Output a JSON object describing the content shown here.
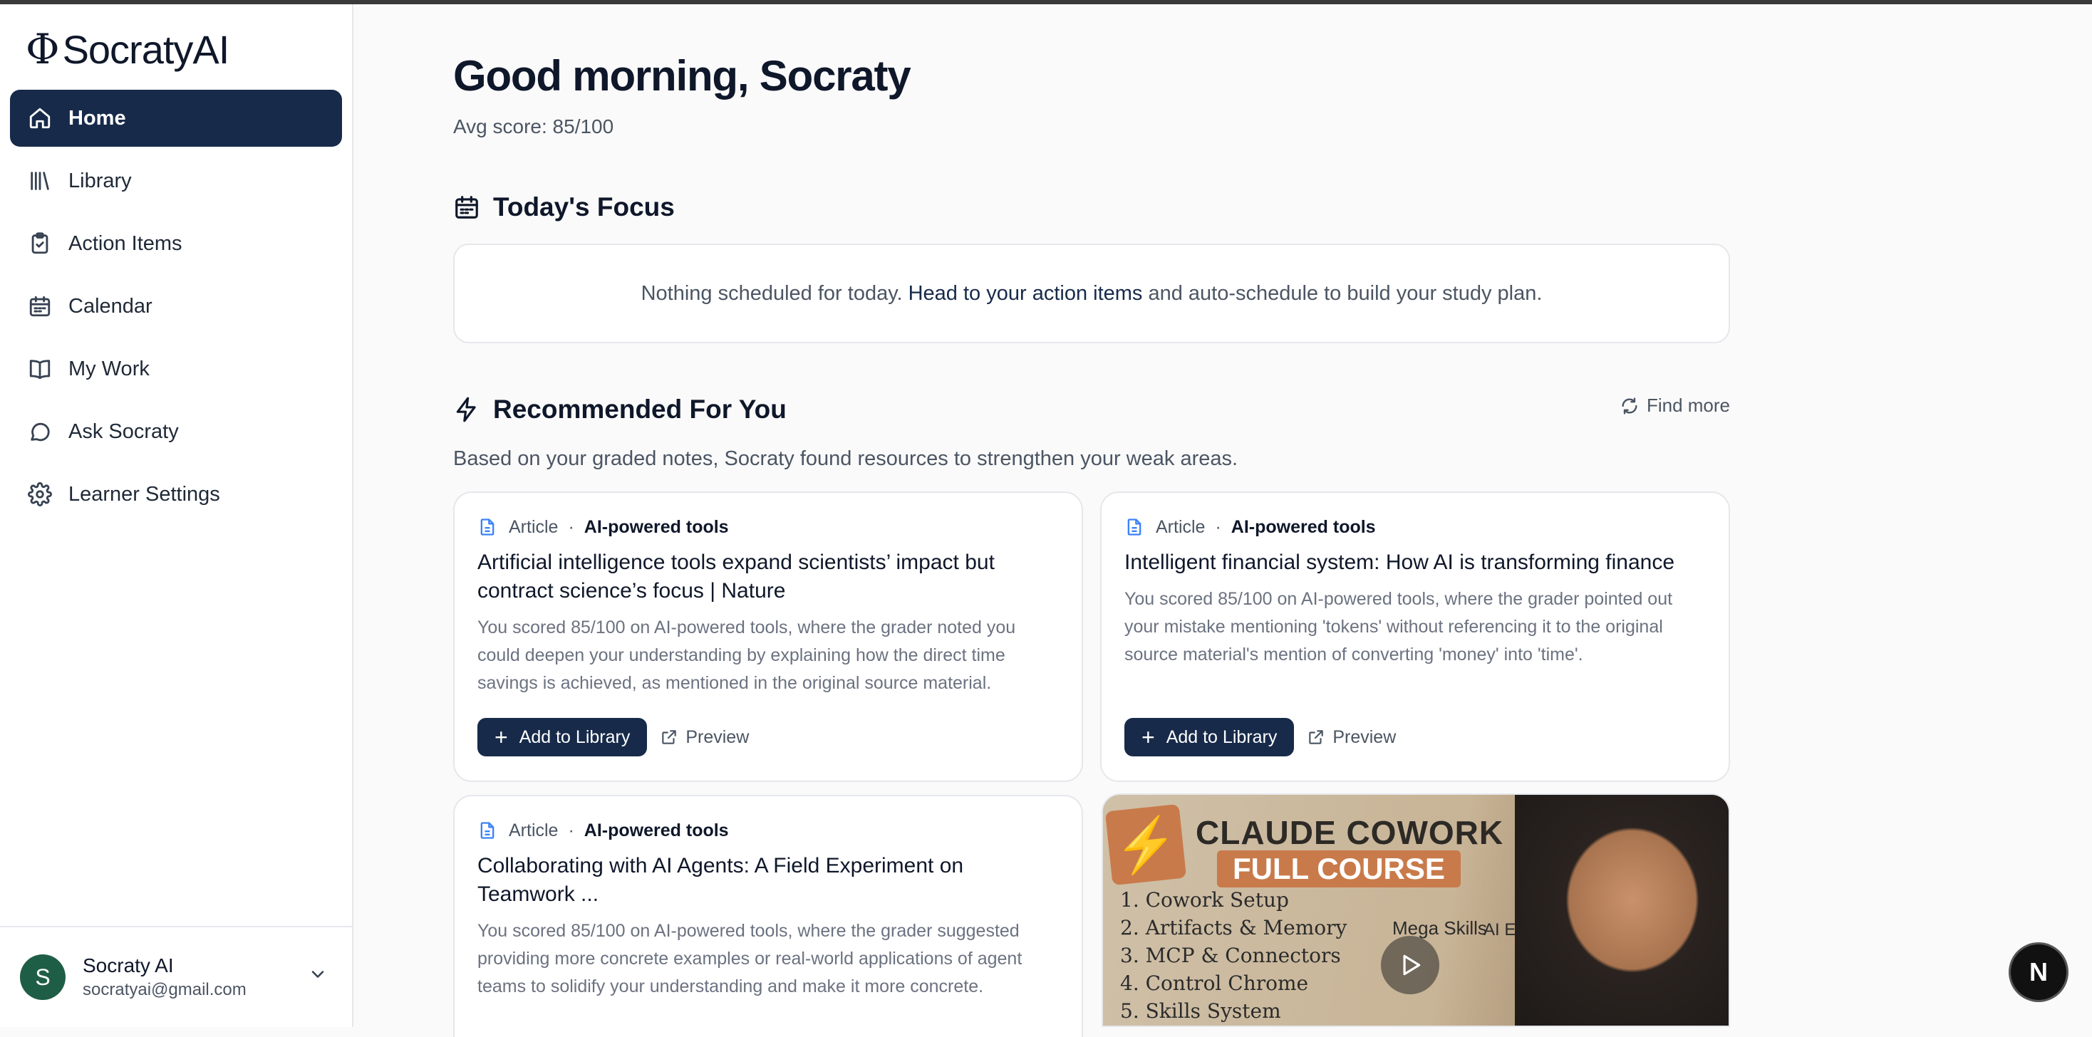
{
  "app": {
    "logo_symbol": "Φ",
    "name": "SocratyAI"
  },
  "sidebar": {
    "items": [
      {
        "label": "Home",
        "icon": "home-icon",
        "active": true
      },
      {
        "label": "Library",
        "icon": "library-icon"
      },
      {
        "label": "Action Items",
        "icon": "clipboard-check-icon"
      },
      {
        "label": "Calendar",
        "icon": "calendar-icon"
      },
      {
        "label": "My Work",
        "icon": "book-open-icon"
      },
      {
        "label": "Ask Socraty",
        "icon": "chat-bubble-icon"
      },
      {
        "label": "Learner Settings",
        "icon": "gear-icon"
      }
    ],
    "user": {
      "initial": "S",
      "name": "Socraty AI",
      "email": "socratyai@gmail.com"
    }
  },
  "main": {
    "greeting": "Good morning, Socraty",
    "avg_score": "Avg score: 85/100",
    "focus": {
      "title": "Today's Focus",
      "text_before": "Nothing scheduled for today.",
      "link": "Head to your action items",
      "text_after": "and auto-schedule to build your study plan."
    },
    "recommended": {
      "title": "Recommended For You",
      "find_more": "Find more",
      "description": "Based on your graded notes, Socraty found resources to strengthen your weak areas.",
      "separator": "·",
      "cards": [
        {
          "type": "Article",
          "tag": "AI-powered tools",
          "title": "Artificial intelligence tools expand scientists’ impact but contract science’s focus | Nature",
          "body": "You scored 85/100 on AI-powered tools, where the grader noted you could deepen your understanding by explaining how the direct time savings is achieved, as mentioned in the original source material.",
          "add_label": "Add to Library",
          "preview_label": "Preview"
        },
        {
          "type": "Article",
          "tag": "AI-powered tools",
          "title": "Intelligent financial system: How AI is transforming finance",
          "body": "You scored 85/100 on AI-powered tools, where the grader pointed out your mistake mentioning 'tokens' without referencing it to the original source material's mention of converting 'money' into 'time'.",
          "add_label": "Add to Library",
          "preview_label": "Preview"
        },
        {
          "type": "Article",
          "tag": "AI-powered tools",
          "title": "Collaborating with AI Agents: A Field Experiment on Teamwork ...",
          "body": "You scored 85/100 on AI-powered tools, where the grader suggested providing more concrete examples or real-world applications of agent teams to solidify your understanding and make it more concrete."
        }
      ],
      "video_thumbnail": {
        "title": "CLAUDE COWORK",
        "badge": "FULL COURSE",
        "items": [
          "1. Cowork Setup",
          "2. Artifacts & Memory",
          "3. MCP & Connectors",
          "4. Control Chrome",
          "5. Skills System"
        ],
        "label_a": "Mega Skills",
        "label_b": "AI Employee"
      }
    }
  },
  "fab": {
    "label": "N"
  },
  "colors": {
    "primary": "#172a4a",
    "background": "#fafafa",
    "muted_text": "#4b5563"
  }
}
